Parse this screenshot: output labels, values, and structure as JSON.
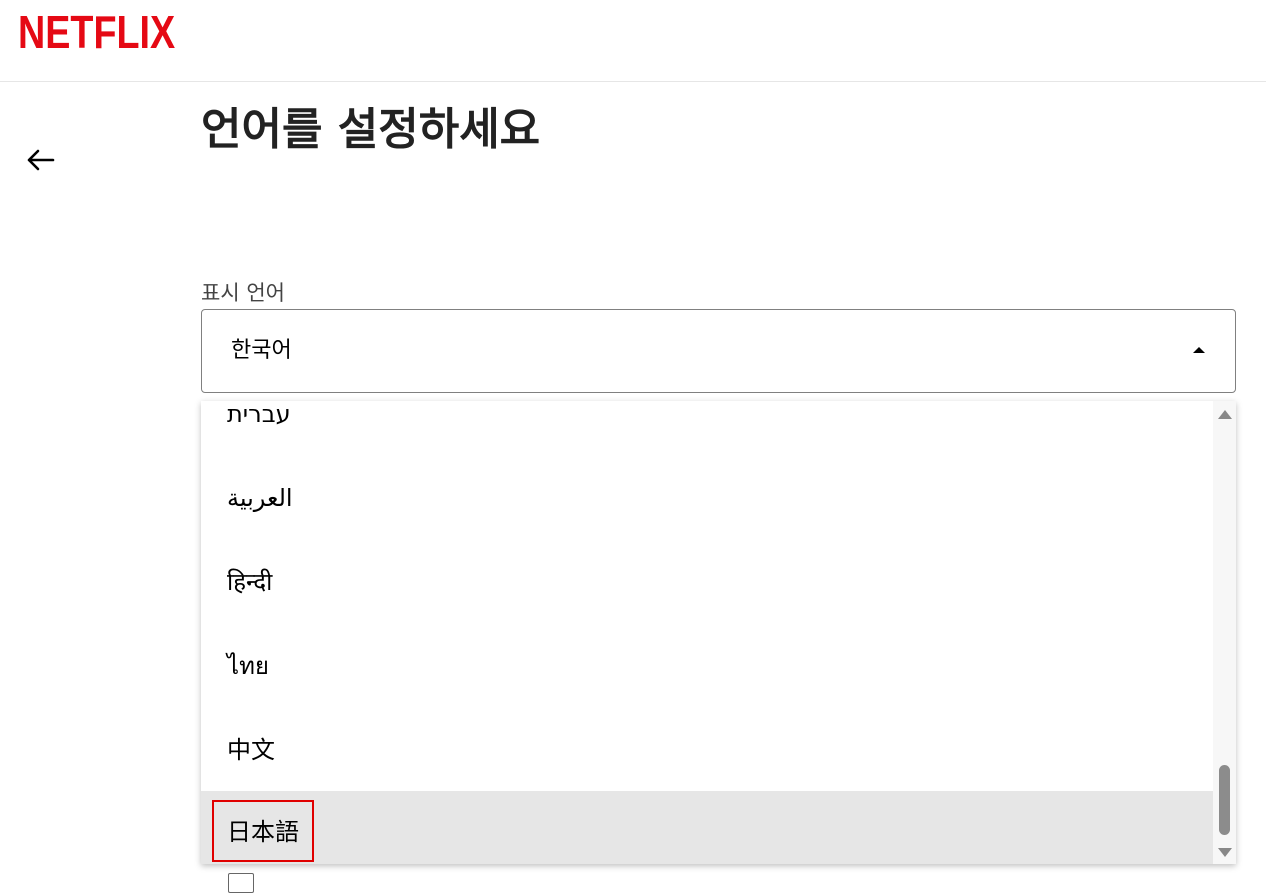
{
  "header": {
    "logo_text": "NETFLIX",
    "brand_color": "#e50914"
  },
  "page": {
    "title": "언어를 설정하세요",
    "back_icon": "arrow-left-icon"
  },
  "display_language": {
    "label": "표시 언어",
    "selected_value": "한국어",
    "caret_icon": "caret-up-icon"
  },
  "dropdown": {
    "options": [
      {
        "label": "עברית"
      },
      {
        "label": "العربية"
      },
      {
        "label": "हिन्दी"
      },
      {
        "label": "ไทย"
      },
      {
        "label": "中文"
      },
      {
        "label": "日本語",
        "highlighted": true
      }
    ],
    "highlight_color": "#e00000",
    "hover_background": "#e6e6e6"
  }
}
